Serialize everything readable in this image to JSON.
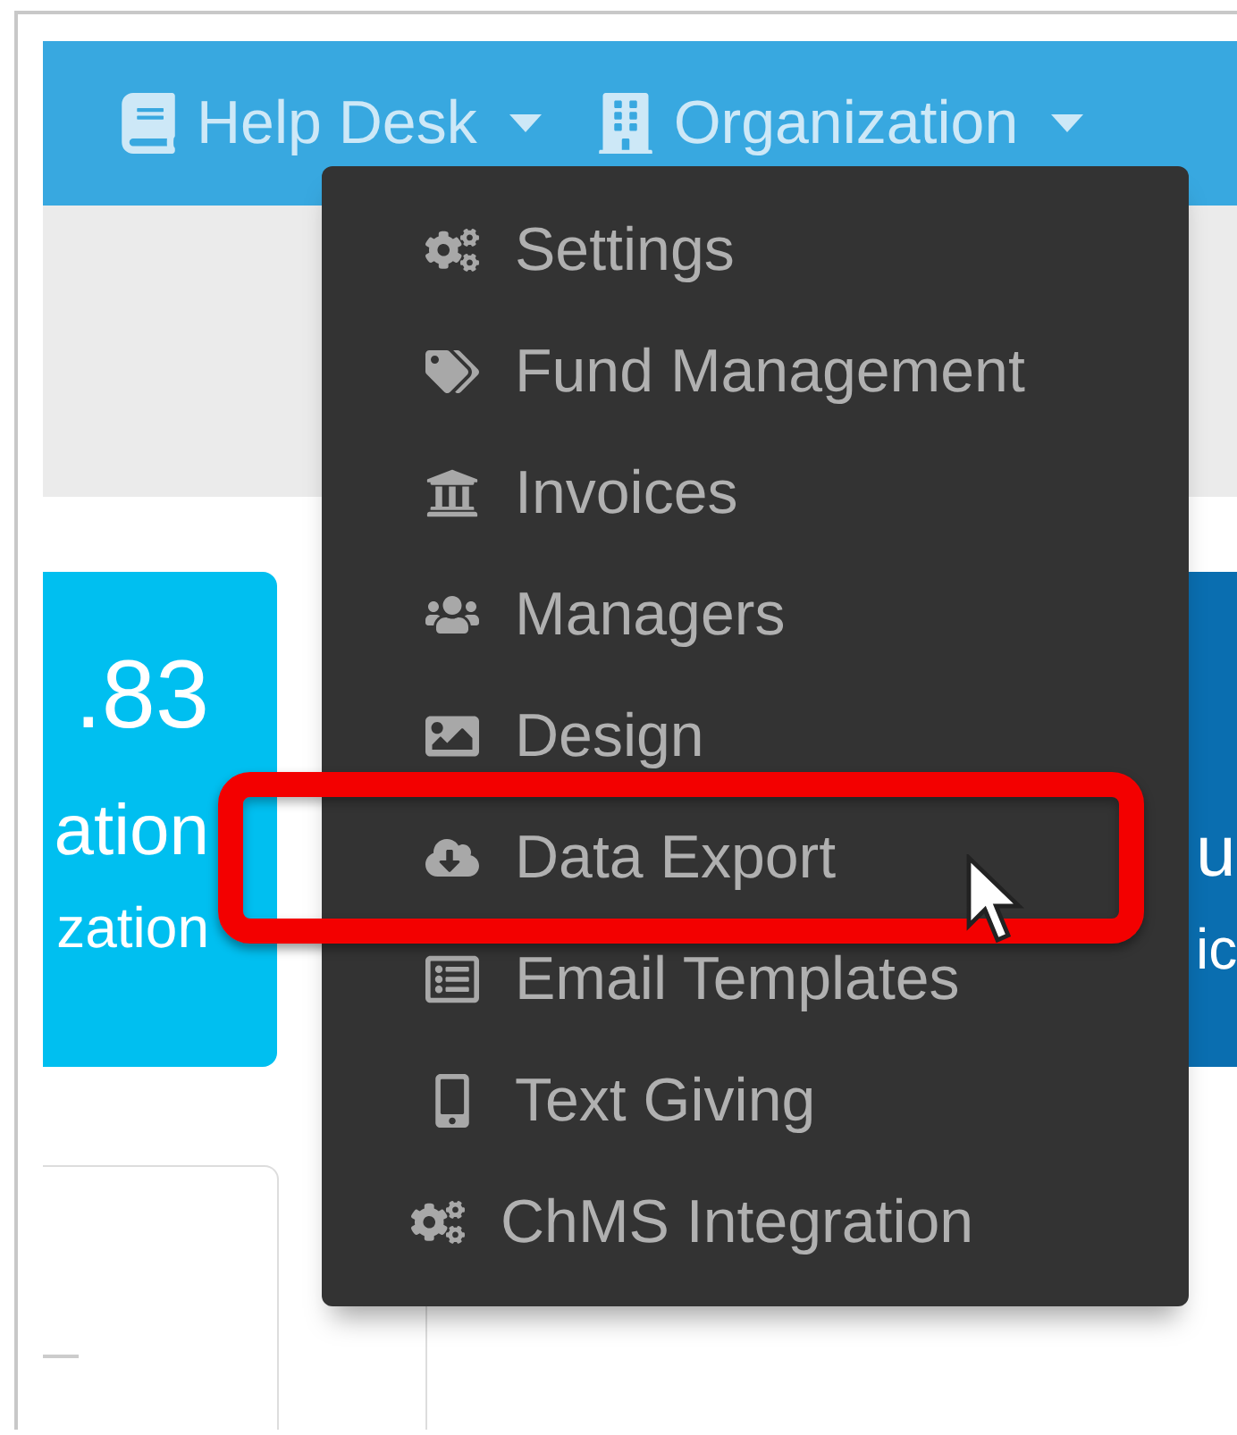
{
  "navbar": {
    "items": [
      {
        "label": "Help Desk"
      },
      {
        "label": "Organization"
      }
    ]
  },
  "cards": [
    {
      "amount": ".83",
      "title": "ation",
      "subtitle": "zation"
    },
    {
      "title": "u",
      "subtitle": "ic"
    }
  ],
  "dropdown": {
    "items": [
      {
        "label": "Settings"
      },
      {
        "label": "Fund Management"
      },
      {
        "label": "Invoices"
      },
      {
        "label": "Managers"
      },
      {
        "label": "Design"
      },
      {
        "label": "Data Export"
      },
      {
        "label": "Email Templates"
      },
      {
        "label": "Text Giving"
      },
      {
        "label": "ChMS Integration"
      }
    ]
  }
}
